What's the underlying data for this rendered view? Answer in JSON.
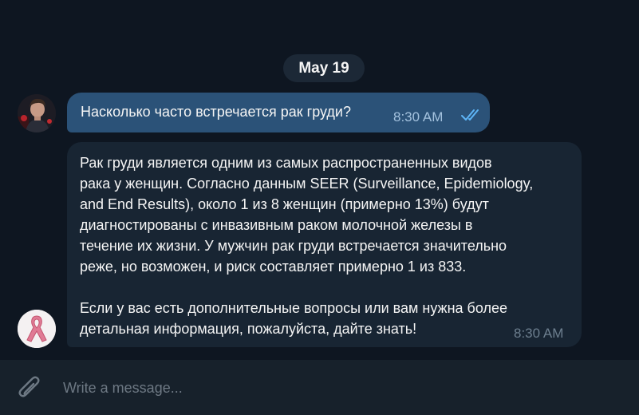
{
  "date_label": "May 19",
  "messages": {
    "user": {
      "text": "Насколько часто встречается рак груди?",
      "time": "8:30 AM",
      "status_icon": "double-check-icon"
    },
    "assistant": {
      "lines_p1": [
        "Рак груди является одним из самых распространенных видов",
        "рака у женщин. Согласно данным SEER (Surveillance, Epidemiology,",
        "and End Results), около 1 из 8 женщин (примерно 13%) будут",
        "диагностированы с инвазивным раком молочной железы в",
        "течение их жизни. У мужчин рак груди встречается значительно",
        "реже, но возможен, и риск составляет примерно 1 из 833."
      ],
      "lines_p2": [
        "Если у вас есть дополнительные вопросы или вам нужна более",
        "детальная информация, пожалуйста, дайте знать!"
      ],
      "time": "8:30 AM"
    }
  },
  "composer": {
    "placeholder": "Write a message...",
    "attach_icon": "paperclip-icon"
  },
  "colors": {
    "background": "#0e1621",
    "outgoing_bubble": "#2b5278",
    "incoming_bubble": "#182533",
    "composer": "#17212b",
    "ribbon": "#e8889f"
  }
}
